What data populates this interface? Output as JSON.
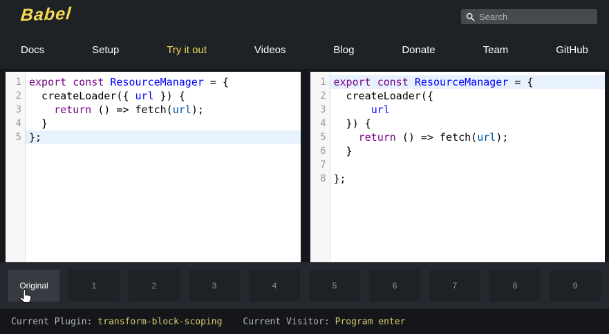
{
  "header": {
    "logo_text": "Babel",
    "search_placeholder": "Search",
    "nav": [
      {
        "label": "Docs",
        "active": false
      },
      {
        "label": "Setup",
        "active": false
      },
      {
        "label": "Try it out",
        "active": true
      },
      {
        "label": "Videos",
        "active": false
      },
      {
        "label": "Blog",
        "active": false
      },
      {
        "label": "Donate",
        "active": false
      },
      {
        "label": "Team",
        "active": false
      },
      {
        "label": "GitHub",
        "active": false
      }
    ]
  },
  "editor": {
    "left": {
      "active_line": 5,
      "lines": [
        {
          "tokens": [
            [
              "k",
              "export"
            ],
            [
              "p",
              " "
            ],
            [
              "k",
              "const"
            ],
            [
              "p",
              " "
            ],
            [
              "d",
              "ResourceManager"
            ],
            [
              "p",
              " = {"
            ]
          ]
        },
        {
          "tokens": [
            [
              "p",
              "  createLoader({ "
            ],
            [
              "d",
              "url"
            ],
            [
              "p",
              " }) {"
            ]
          ]
        },
        {
          "tokens": [
            [
              "p",
              "    "
            ],
            [
              "k",
              "return"
            ],
            [
              "p",
              " () => fetch("
            ],
            [
              "v",
              "url"
            ],
            [
              "p",
              ");"
            ]
          ]
        },
        {
          "tokens": [
            [
              "p",
              "  }"
            ]
          ]
        },
        {
          "tokens": [
            [
              "p",
              "};"
            ]
          ]
        }
      ]
    },
    "right": {
      "active_line": 1,
      "lines": [
        {
          "tokens": [
            [
              "k",
              "export"
            ],
            [
              "p",
              " "
            ],
            [
              "k",
              "const"
            ],
            [
              "p",
              " "
            ],
            [
              "d",
              "ResourceManager"
            ],
            [
              "p",
              " = {"
            ]
          ]
        },
        {
          "tokens": [
            [
              "p",
              "  createLoader({"
            ]
          ]
        },
        {
          "tokens": [
            [
              "p",
              "      "
            ],
            [
              "d",
              "url"
            ]
          ]
        },
        {
          "tokens": [
            [
              "p",
              "  }) {"
            ]
          ]
        },
        {
          "tokens": [
            [
              "p",
              "    "
            ],
            [
              "k",
              "return"
            ],
            [
              "p",
              " () => fetch("
            ],
            [
              "v",
              "url"
            ],
            [
              "p",
              ");"
            ]
          ]
        },
        {
          "tokens": [
            [
              "p",
              "  }"
            ]
          ]
        },
        {
          "tokens": []
        },
        {
          "tokens": [
            [
              "p",
              "};"
            ]
          ]
        }
      ]
    }
  },
  "toolbar": {
    "selected_index": 0,
    "buttons": [
      "Original",
      "1",
      "2",
      "3",
      "4",
      "5",
      "6",
      "7",
      "8",
      "9"
    ]
  },
  "statusbar": {
    "plugin_label": "Current Plugin:",
    "plugin_value": "transform-block-scoping",
    "visitor_label": "Current Visitor:",
    "visitor_value": "Program enter"
  },
  "colors": {
    "babel_yellow": "#f5da55",
    "active_line_bg": "#e8f2ff",
    "keyword": "#770088",
    "definition": "#0000ff",
    "variable": "#0055aa",
    "status_value": "#d9ce6d"
  }
}
